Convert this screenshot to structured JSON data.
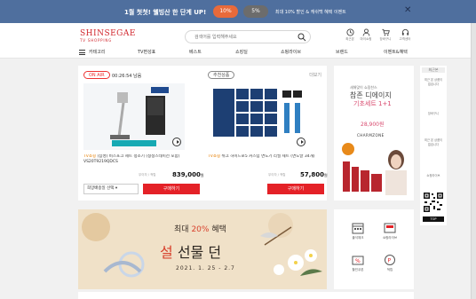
{
  "top_banner": {
    "text": "1월 첫첫! 웰빙산 한 단계 UP!",
    "coupon1": "10%",
    "coupon2": "5%",
    "subtext": "최대 10% 할인 & 캐쉬백 혜택 이벤트"
  },
  "header": {
    "logo_main": "SHINSEGAE",
    "logo_sub": "TV SHOPPING",
    "search_placeholder": "검색어를 입력해주세요",
    "icons": [
      {
        "label": "최근본",
        "icon": "clock-icon"
      },
      {
        "label": "마이쇼핑",
        "icon": "user-icon"
      },
      {
        "label": "장바구니",
        "icon": "cart-icon"
      },
      {
        "label": "고객센터",
        "icon": "headset-icon"
      }
    ]
  },
  "nav": {
    "items": [
      "카테고리",
      "TV편성표",
      "베스트",
      "쇼킹딜",
      "쇼핑라이브",
      "브랜드",
      "이벤트&혜택"
    ]
  },
  "onair": {
    "badge": "ON AIR",
    "time": "00:26:54 남음",
    "badge2": "추천상품",
    "more": "더보기",
    "products": [
      {
        "tag": "TV쇼핑",
        "title": "(삼성) 비스포크 제트 청소기 (청정스테이션 포함) VS20T9219QDCS",
        "price": "839,000",
        "won": "원",
        "note": "무이자 / 적립",
        "select": "희망배송일 선택"
      },
      {
        "tag": "TV쇼핑",
        "title": "쉬크 하이드로5 커스텀 면도기 리필 세트 (면도날 34개)",
        "price": "57,800",
        "won": "원",
        "note": "무이자 / 적립"
      }
    ],
    "buy_label": "구매하기"
  },
  "promo": {
    "sub": "새해맞이 쇼핑찬스",
    "title": "참존 디에이지",
    "title2": "기초세트 1+1",
    "price": "28,900원",
    "brand": "CHARMZONE"
  },
  "banner": {
    "line1_prefix": "최대",
    "line1_accent": "20%",
    "line1_suffix": "혜택",
    "line2_accent": "설",
    "line2_rest": "선물 던",
    "date": "2021. 1. 25 - 2.7"
  },
  "quick_menu": {
    "items": [
      {
        "label": "출석체크",
        "icon": "calendar-icon"
      },
      {
        "label": "쇼핑라이브",
        "icon": "live-icon"
      },
      {
        "label": "할인쿠폰",
        "icon": "coupon-icon"
      },
      {
        "label": "적립",
        "icon": "point-icon"
      }
    ]
  },
  "rail": {
    "top": "최근본",
    "texts": [
      "최근 본 상품이 없습니다",
      "장바구니",
      "최근 본 상품이 없습니다",
      "쇼핑라이브"
    ],
    "bottom": "TOP"
  },
  "colors": {
    "brand_red": "#d1262d",
    "buy_red": "#e42127",
    "banner_blue": "#4f6f9e"
  }
}
